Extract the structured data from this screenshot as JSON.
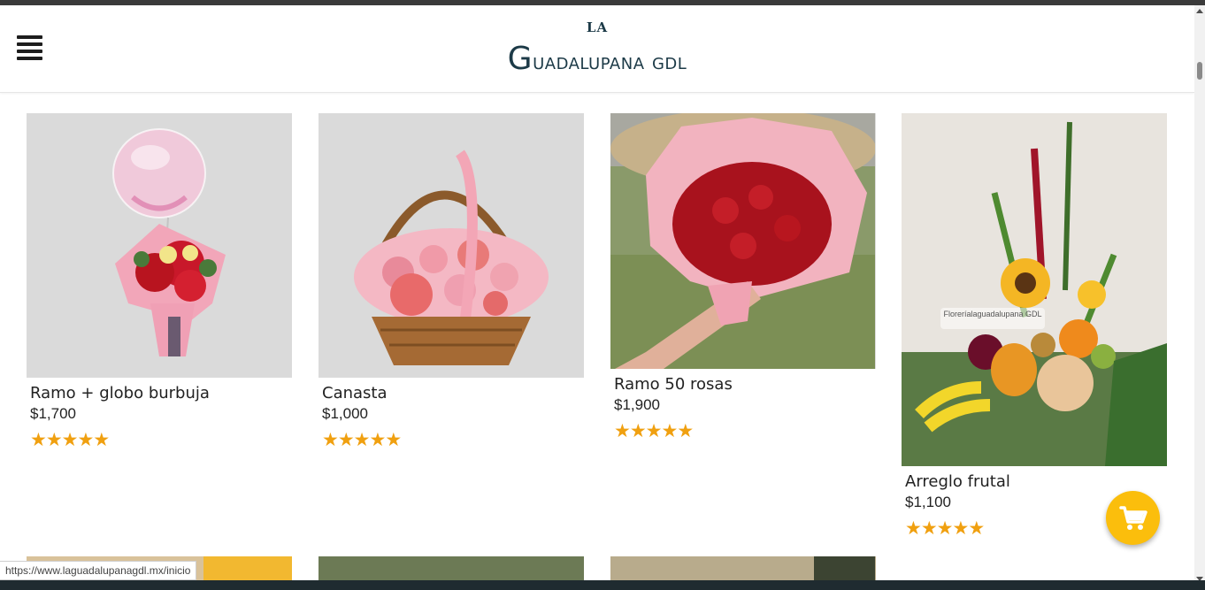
{
  "brand": {
    "small": "LA",
    "big_cap": "G",
    "big_rest": "uadalupana gdl"
  },
  "products": [
    {
      "name": "Ramo + globo burbuja",
      "price": "$1,700",
      "rating": 5
    },
    {
      "name": "Canasta",
      "price": "$1,000",
      "rating": 5
    },
    {
      "name": "Ramo 50 rosas",
      "price": "$1,900",
      "rating": 5
    },
    {
      "name": "Arreglo frutal",
      "price": "$1,100",
      "rating": 5
    }
  ],
  "status_bar": {
    "url": "https://www.laguadalupanagdl.mx/inicio"
  },
  "image_watermark": "Floreríalaguadalupana GDL",
  "icons": {
    "menu": "hamburger-menu-icon",
    "cart": "shopping-cart-icon",
    "star": "star-icon"
  },
  "colors": {
    "brand": "#1c3a47",
    "star": "#f0a010",
    "cart_button": "#fbbe0c"
  }
}
